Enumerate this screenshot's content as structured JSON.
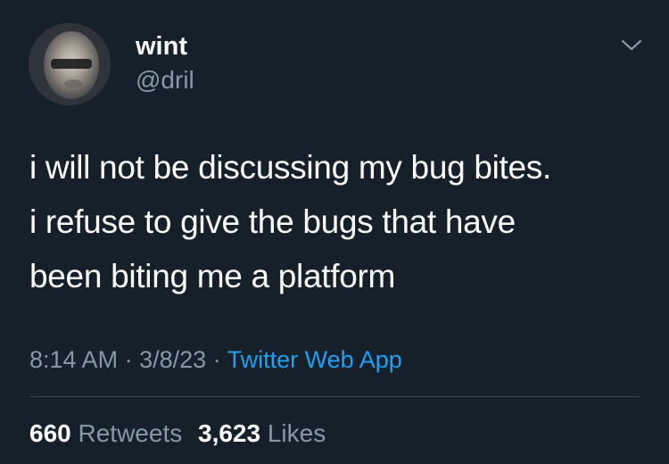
{
  "user": {
    "display_name": "wint",
    "handle": "@dril"
  },
  "tweet": {
    "lines": [
      "i will not be discussing my bug bites.",
      "i refuse to give the bugs that have",
      "been biting me a platform"
    ],
    "time": "8:14 AM",
    "separator_1": " · ",
    "date": "3/8/23",
    "separator_2": " · ",
    "source": "Twitter Web App"
  },
  "stats": {
    "retweets_count": "660",
    "retweets_label": "Retweets",
    "likes_count": "3,623",
    "likes_label": "Likes"
  },
  "icons": {
    "menu": "chevron-down-icon"
  },
  "colors": {
    "background": "#15202b",
    "primary_text": "#ffffff",
    "secondary_text": "#8899a6",
    "link": "#1da1f2",
    "divider": "#38444d"
  }
}
